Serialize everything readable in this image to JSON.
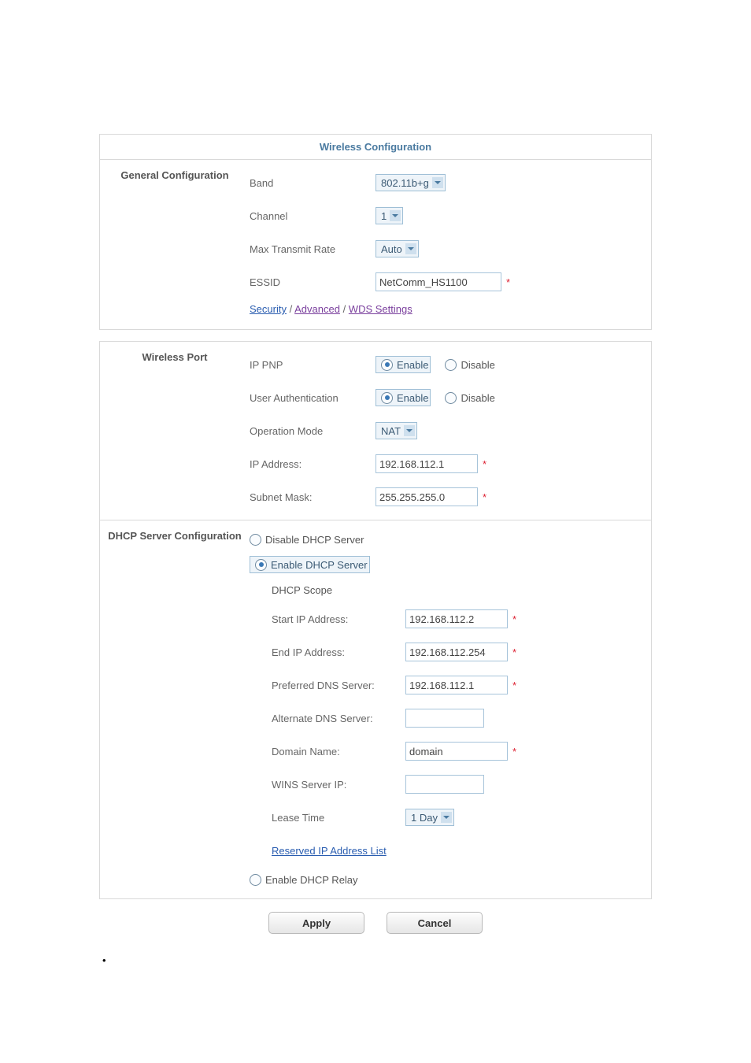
{
  "panel": {
    "title": "Wireless Configuration"
  },
  "general": {
    "heading": "General Configuration",
    "band_label": "Band",
    "band_value": "802.11b+g",
    "channel_label": "Channel",
    "channel_value": "1",
    "maxrate_label": "Max Transmit Rate",
    "maxrate_value": "Auto",
    "essid_label": "ESSID",
    "essid_value": "NetComm_HS1100",
    "links": {
      "security": "Security",
      "advanced": "Advanced",
      "wds": "WDS Settings",
      "sep": " / "
    }
  },
  "wport": {
    "heading": "Wireless Port",
    "ippnp_label": "IP PNP",
    "auth_label": "User Authentication",
    "opmode_label": "Operation Mode",
    "opmode_value": "NAT",
    "ipaddr_label": "IP Address:",
    "ipaddr_value": "192.168.112.1",
    "mask_label": "Subnet Mask:",
    "mask_value": "255.255.255.0",
    "enable": "Enable",
    "disable": "Disable"
  },
  "dhcp": {
    "heading": "DHCP Server Configuration",
    "disable_server": "Disable DHCP Server",
    "enable_server": "Enable DHCP Server",
    "scope": "DHCP Scope",
    "start_label": "Start IP Address:",
    "start_value": "192.168.112.2",
    "end_label": "End IP Address:",
    "end_value": "192.168.112.254",
    "pdns_label": "Preferred DNS Server:",
    "pdns_value": "192.168.112.1",
    "adns_label": "Alternate DNS Server:",
    "adns_value": "",
    "domain_label": "Domain Name:",
    "domain_value": "domain",
    "wins_label": "WINS Server IP:",
    "wins_value": "",
    "lease_label": "Lease Time",
    "lease_value": "1 Day",
    "reserved_link": "Reserved IP Address List",
    "enable_relay": "Enable DHCP Relay"
  },
  "buttons": {
    "apply": "Apply",
    "cancel": "Cancel"
  },
  "req": "*",
  "bullet": "•"
}
